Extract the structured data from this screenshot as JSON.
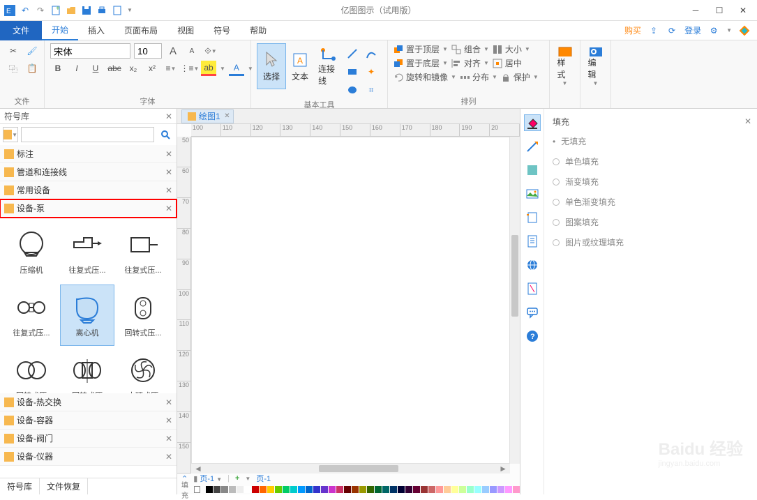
{
  "titlebar": {
    "title": "亿图图示（试用版）"
  },
  "menu": {
    "file": "文件",
    "tabs": [
      "开始",
      "插入",
      "页面布局",
      "视图",
      "符号",
      "帮助"
    ],
    "active": 0,
    "buy": "购买",
    "login": "登录"
  },
  "ribbon": {
    "file_group": "文件",
    "font_group": "字体",
    "font_name": "宋体",
    "font_size": "10",
    "tools_group": "基本工具",
    "select": "选择",
    "text": "文本",
    "connector": "连接线",
    "arrange_group": "排列",
    "bring_front": "置于顶层",
    "send_back": "置于底层",
    "rotate": "旋转和镜像",
    "group": "组合",
    "align": "对齐",
    "distribute": "分布",
    "size": "大小",
    "center": "居中",
    "lock": "保护",
    "style_group": "样式",
    "edit_group": "编辑"
  },
  "doc": {
    "tab": "绘图1"
  },
  "left": {
    "title": "符号库",
    "cats": [
      "标注",
      "管道和连接线",
      "常用设备",
      "设备-泵",
      "设备-热交换",
      "设备-容器",
      "设备-阀门",
      "设备-仪器"
    ],
    "highlight_index": 3,
    "shapes": [
      "压缩机",
      "往复式压...",
      "往复式压...",
      "往复式压...",
      "离心机",
      "回转式压...",
      "回转式压",
      "回转式压",
      "水环式压"
    ],
    "selected_shape_index": 4,
    "bottom_tabs": [
      "符号库",
      "文件恢复"
    ]
  },
  "ruler_h": [
    "100",
    "110",
    "120",
    "130",
    "140",
    "150",
    "160",
    "170",
    "180",
    "190",
    "20"
  ],
  "ruler_v": [
    "50",
    "60",
    "70",
    "80",
    "90",
    "100",
    "110",
    "120",
    "130",
    "140",
    "150"
  ],
  "pagebar": {
    "page": "页-1",
    "addpage": "页-1"
  },
  "status": {
    "fill_label": "填充"
  },
  "right": {
    "title": "填充",
    "options": [
      "无填充",
      "单色填充",
      "渐变填充",
      "单色渐变填充",
      "图案填充",
      "图片或纹理填充"
    ]
  },
  "swatch_colors": [
    "#000",
    "#444",
    "#888",
    "#bbb",
    "#eee",
    "#fff",
    "#c00",
    "#f60",
    "#fc0",
    "#6c0",
    "#0c6",
    "#0cc",
    "#09f",
    "#06c",
    "#33c",
    "#63c",
    "#c3c",
    "#c36",
    "#600",
    "#930",
    "#990",
    "#360",
    "#063",
    "#066",
    "#036",
    "#003",
    "#303",
    "#603",
    "#933",
    "#c66",
    "#f99",
    "#fc9",
    "#ff9",
    "#cf9",
    "#9fc",
    "#9ff",
    "#9cf",
    "#99f",
    "#c9f",
    "#f9f",
    "#f9c"
  ]
}
